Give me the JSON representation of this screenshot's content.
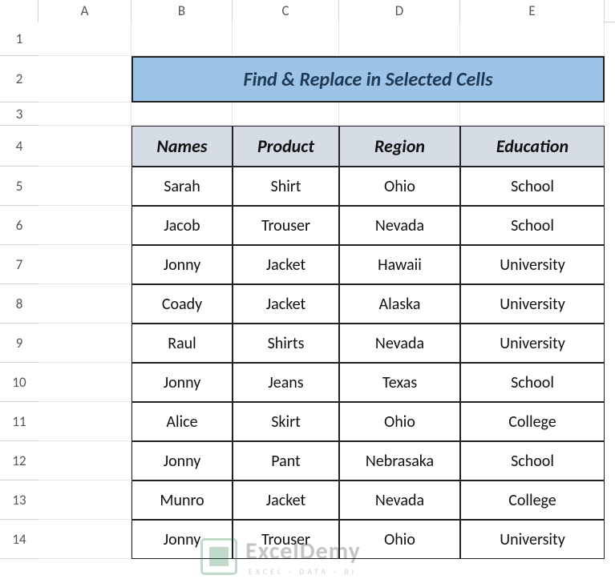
{
  "columns": {
    "labels": [
      "A",
      "B",
      "C",
      "D",
      "E"
    ],
    "widths": [
      116,
      126,
      133,
      151,
      180
    ]
  },
  "rows": {
    "count": 14,
    "heights": [
      42,
      58,
      29,
      51,
      49,
      49,
      49,
      49,
      49,
      49,
      49,
      49,
      49,
      49
    ]
  },
  "title": "Find & Replace in Selected Cells",
  "headers": [
    "Names",
    "Product",
    "Region",
    "Education"
  ],
  "chart_data": {
    "type": "table",
    "columns": [
      "Names",
      "Product",
      "Region",
      "Education"
    ],
    "rows": [
      [
        "Sarah",
        "Shirt",
        "Ohio",
        "School"
      ],
      [
        "Jacob",
        "Trouser",
        "Nevada",
        "School"
      ],
      [
        "Jonny",
        "Jacket",
        "Hawaii",
        "University"
      ],
      [
        "Coady",
        "Jacket",
        "Alaska",
        "University"
      ],
      [
        "Raul",
        "Shirts",
        "Nevada",
        "University"
      ],
      [
        "Jonny",
        "Jeans",
        "Texas",
        "School"
      ],
      [
        "Alice",
        "Skirt",
        "Ohio",
        "College"
      ],
      [
        "Jonny",
        "Pant",
        "Nebrasaka",
        "School"
      ],
      [
        "Munro",
        "Jacket",
        "Nevada",
        "College"
      ],
      [
        "Jonny",
        "Trouser",
        "Ohio",
        "University"
      ]
    ]
  },
  "watermark": {
    "brand": "ExcelDemy",
    "tagline": "EXCEL · DATA · BI"
  }
}
